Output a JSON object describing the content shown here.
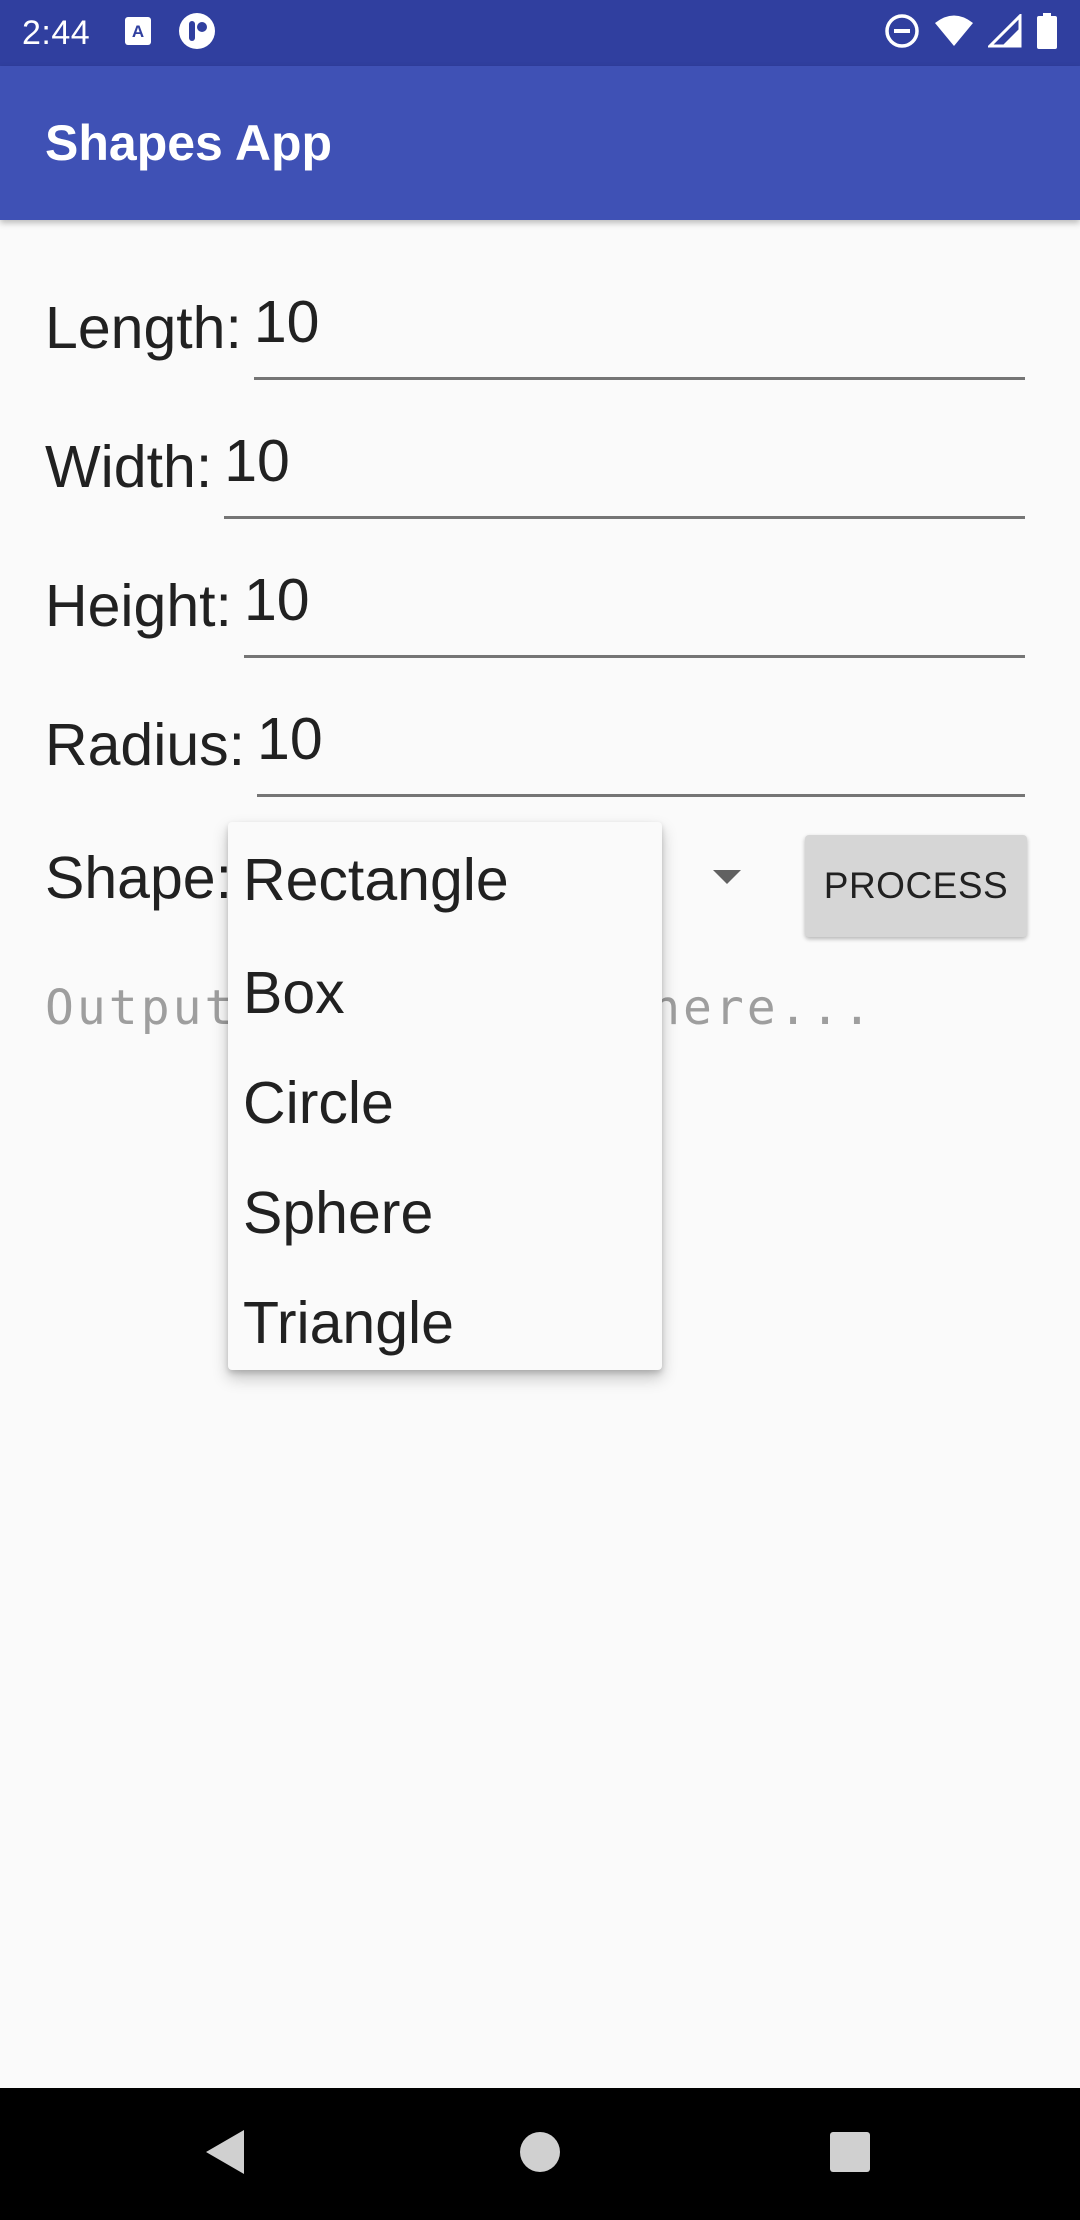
{
  "status_bar": {
    "time": "2:44",
    "left_icons": [
      "keyboard-a-icon",
      "app-notification-icon"
    ],
    "right_icons": [
      "do-not-disturb-icon",
      "wifi-icon",
      "cell-signal-icon",
      "battery-icon"
    ]
  },
  "app_bar": {
    "title": "Shapes App"
  },
  "form": {
    "length": {
      "label": "Length:",
      "value": "10"
    },
    "width": {
      "label": "Width:",
      "value": "10"
    },
    "height": {
      "label": "Height:",
      "value": "10"
    },
    "radius": {
      "label": "Radius:",
      "value": "10"
    },
    "shape": {
      "label": "Shape:"
    },
    "process_button": "PROCESS",
    "output_placeholder": "Output will appear here..."
  },
  "dropdown": {
    "options": [
      "Rectangle",
      "Box",
      "Circle",
      "Sphere",
      "Triangle"
    ]
  },
  "nav_bar": {
    "buttons": [
      "back-icon",
      "home-icon",
      "recents-icon"
    ]
  },
  "colors": {
    "status_bar": "#303f9f",
    "app_bar": "#3f51b5",
    "background": "#fafafa",
    "button": "#d6d6d6"
  }
}
